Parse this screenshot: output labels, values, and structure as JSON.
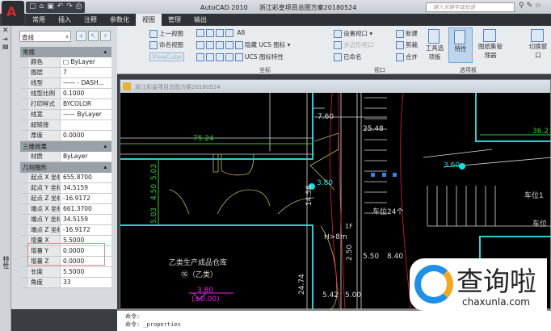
{
  "app": {
    "title": "AutoCAD 2010",
    "document": "浙江彩皇项目总图方案20180524",
    "search_placeholder": "键入关键字或短语"
  },
  "tabs": [
    "常用",
    "插入",
    "注释",
    "参数化",
    "视图",
    "管理",
    "输出"
  ],
  "active_tab": "视图",
  "ribbon": {
    "views": [
      "上一视图",
      "命名视图",
      "ViewCube"
    ],
    "ucs": {
      "name": "A8",
      "ucs_icon": "隐藏 UCS 图标",
      "ucs_props": "UCS 图标特性"
    },
    "viewport": [
      "设置视口",
      "多边形视口",
      "已命名",
      "新建",
      "剪裁",
      "合并"
    ],
    "palettes": [
      "工具选项板",
      "特性",
      "图纸集管理器"
    ],
    "window": "切换窗口",
    "panel_labels": {
      "coords": "坐标",
      "viewport": "视口",
      "palettes": "选项板"
    }
  },
  "properties": {
    "object_type": "直线",
    "sections": [
      {
        "title": "常规",
        "rows": [
          [
            "颜色",
            "□ ByLayer"
          ],
          [
            "图层",
            "7"
          ],
          [
            "线型",
            "—— - DASH..."
          ],
          [
            "线型比例",
            "0.1000"
          ],
          [
            "打印样式",
            "BYCOLOR"
          ],
          [
            "线宽",
            "—— ByLayer"
          ],
          [
            "超链接",
            ""
          ],
          [
            "厚度",
            "0.0000"
          ]
        ]
      },
      {
        "title": "三维效果",
        "rows": [
          [
            "材质",
            "ByLayer"
          ]
        ]
      },
      {
        "title": "几何图形",
        "rows": [
          [
            "起点 X 坐标",
            "655.8700"
          ],
          [
            "起点 Y 坐标",
            "34.5159"
          ],
          [
            "起点 Z 坐标",
            "-16.9172"
          ],
          [
            "端点 X 坐标",
            "661.3700"
          ],
          [
            "端点 Y 坐标",
            "34.5159"
          ],
          [
            "端点 Z 坐标",
            "-16.9172"
          ],
          [
            "增量 X",
            "5.5000"
          ],
          [
            "增量 Y",
            "0.0000"
          ],
          [
            "增量 Z",
            "0.0000"
          ],
          [
            "长度",
            "5.5000"
          ],
          [
            "角度",
            "33"
          ]
        ]
      }
    ],
    "side_label": "特性"
  },
  "drawing": {
    "labels": [
      "75.24",
      "7.60",
      "25.48",
      "36.2",
      "3.60",
      "3.80",
      "14.56",
      "5.03",
      "4.50",
      "5.03",
      "车位24个",
      "车位1",
      "车位",
      "1F",
      "H>8m",
      "乙类生产成品仓库",
      "⑯（乙类）",
      "3.80",
      "(±0.00)",
      "24.74",
      "2.50",
      "5.50",
      "8.40",
      "5.42",
      "5.00"
    ]
  },
  "command": {
    "lines": [
      "命令:",
      "命令: _properties"
    ]
  },
  "watermark": {
    "name": "查询啦",
    "url": "chaxunla.com"
  }
}
